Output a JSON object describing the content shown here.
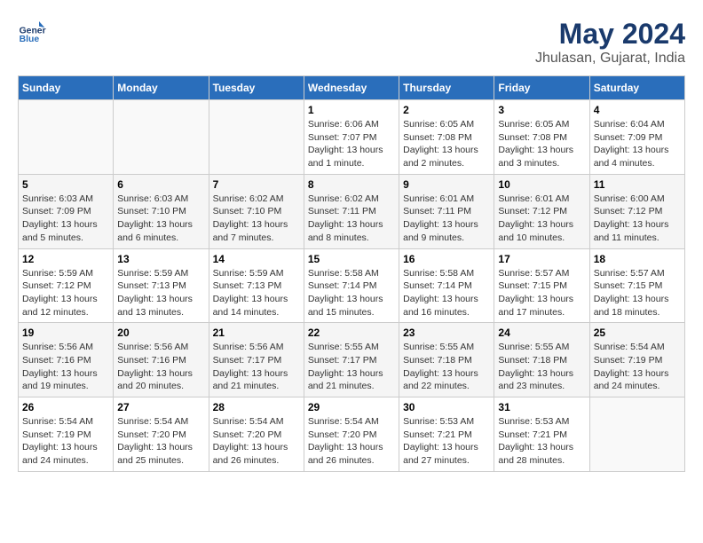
{
  "header": {
    "logo_line1": "General",
    "logo_line2": "Blue",
    "title": "May 2024",
    "subtitle": "Jhulasan, Gujarat, India"
  },
  "weekdays": [
    "Sunday",
    "Monday",
    "Tuesday",
    "Wednesday",
    "Thursday",
    "Friday",
    "Saturday"
  ],
  "weeks": [
    [
      {
        "day": "",
        "info": ""
      },
      {
        "day": "",
        "info": ""
      },
      {
        "day": "",
        "info": ""
      },
      {
        "day": "1",
        "info": "Sunrise: 6:06 AM\nSunset: 7:07 PM\nDaylight: 13 hours and 1 minute."
      },
      {
        "day": "2",
        "info": "Sunrise: 6:05 AM\nSunset: 7:08 PM\nDaylight: 13 hours and 2 minutes."
      },
      {
        "day": "3",
        "info": "Sunrise: 6:05 AM\nSunset: 7:08 PM\nDaylight: 13 hours and 3 minutes."
      },
      {
        "day": "4",
        "info": "Sunrise: 6:04 AM\nSunset: 7:09 PM\nDaylight: 13 hours and 4 minutes."
      }
    ],
    [
      {
        "day": "5",
        "info": "Sunrise: 6:03 AM\nSunset: 7:09 PM\nDaylight: 13 hours and 5 minutes."
      },
      {
        "day": "6",
        "info": "Sunrise: 6:03 AM\nSunset: 7:10 PM\nDaylight: 13 hours and 6 minutes."
      },
      {
        "day": "7",
        "info": "Sunrise: 6:02 AM\nSunset: 7:10 PM\nDaylight: 13 hours and 7 minutes."
      },
      {
        "day": "8",
        "info": "Sunrise: 6:02 AM\nSunset: 7:11 PM\nDaylight: 13 hours and 8 minutes."
      },
      {
        "day": "9",
        "info": "Sunrise: 6:01 AM\nSunset: 7:11 PM\nDaylight: 13 hours and 9 minutes."
      },
      {
        "day": "10",
        "info": "Sunrise: 6:01 AM\nSunset: 7:12 PM\nDaylight: 13 hours and 10 minutes."
      },
      {
        "day": "11",
        "info": "Sunrise: 6:00 AM\nSunset: 7:12 PM\nDaylight: 13 hours and 11 minutes."
      }
    ],
    [
      {
        "day": "12",
        "info": "Sunrise: 5:59 AM\nSunset: 7:12 PM\nDaylight: 13 hours and 12 minutes."
      },
      {
        "day": "13",
        "info": "Sunrise: 5:59 AM\nSunset: 7:13 PM\nDaylight: 13 hours and 13 minutes."
      },
      {
        "day": "14",
        "info": "Sunrise: 5:59 AM\nSunset: 7:13 PM\nDaylight: 13 hours and 14 minutes."
      },
      {
        "day": "15",
        "info": "Sunrise: 5:58 AM\nSunset: 7:14 PM\nDaylight: 13 hours and 15 minutes."
      },
      {
        "day": "16",
        "info": "Sunrise: 5:58 AM\nSunset: 7:14 PM\nDaylight: 13 hours and 16 minutes."
      },
      {
        "day": "17",
        "info": "Sunrise: 5:57 AM\nSunset: 7:15 PM\nDaylight: 13 hours and 17 minutes."
      },
      {
        "day": "18",
        "info": "Sunrise: 5:57 AM\nSunset: 7:15 PM\nDaylight: 13 hours and 18 minutes."
      }
    ],
    [
      {
        "day": "19",
        "info": "Sunrise: 5:56 AM\nSunset: 7:16 PM\nDaylight: 13 hours and 19 minutes."
      },
      {
        "day": "20",
        "info": "Sunrise: 5:56 AM\nSunset: 7:16 PM\nDaylight: 13 hours and 20 minutes."
      },
      {
        "day": "21",
        "info": "Sunrise: 5:56 AM\nSunset: 7:17 PM\nDaylight: 13 hours and 21 minutes."
      },
      {
        "day": "22",
        "info": "Sunrise: 5:55 AM\nSunset: 7:17 PM\nDaylight: 13 hours and 21 minutes."
      },
      {
        "day": "23",
        "info": "Sunrise: 5:55 AM\nSunset: 7:18 PM\nDaylight: 13 hours and 22 minutes."
      },
      {
        "day": "24",
        "info": "Sunrise: 5:55 AM\nSunset: 7:18 PM\nDaylight: 13 hours and 23 minutes."
      },
      {
        "day": "25",
        "info": "Sunrise: 5:54 AM\nSunset: 7:19 PM\nDaylight: 13 hours and 24 minutes."
      }
    ],
    [
      {
        "day": "26",
        "info": "Sunrise: 5:54 AM\nSunset: 7:19 PM\nDaylight: 13 hours and 24 minutes."
      },
      {
        "day": "27",
        "info": "Sunrise: 5:54 AM\nSunset: 7:20 PM\nDaylight: 13 hours and 25 minutes."
      },
      {
        "day": "28",
        "info": "Sunrise: 5:54 AM\nSunset: 7:20 PM\nDaylight: 13 hours and 26 minutes."
      },
      {
        "day": "29",
        "info": "Sunrise: 5:54 AM\nSunset: 7:20 PM\nDaylight: 13 hours and 26 minutes."
      },
      {
        "day": "30",
        "info": "Sunrise: 5:53 AM\nSunset: 7:21 PM\nDaylight: 13 hours and 27 minutes."
      },
      {
        "day": "31",
        "info": "Sunrise: 5:53 AM\nSunset: 7:21 PM\nDaylight: 13 hours and 28 minutes."
      },
      {
        "day": "",
        "info": ""
      }
    ]
  ]
}
